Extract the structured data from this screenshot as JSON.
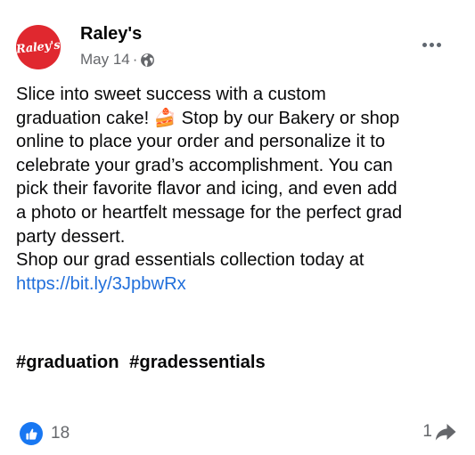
{
  "post": {
    "author": "Raley's",
    "avatar_text": "Raley's",
    "date": "May 14",
    "separator": "·",
    "text_lines": [
      "Slice into sweet success with a custom",
      "graduation cake! 🍰 Stop by our Bakery or shop",
      "online to place your order and personalize it to",
      "celebrate your grad’s accomplishment. You can",
      "pick their favorite flavor and icing, and even add",
      "a photo or heartfelt message for the perfect grad",
      "party dessert.",
      "Shop our grad essentials collection today at"
    ],
    "link": "https://bit.ly/3JpbwRx",
    "hashtags": [
      "#graduation",
      "#gradessentials"
    ],
    "reaction_count": "18",
    "share_count": "1",
    "icons": {
      "audience": "globe-icon",
      "menu": "more-options-icon",
      "reaction": "thumbs-up-icon",
      "share": "share-arrow-icon"
    },
    "colors": {
      "brand_red": "#e0282f",
      "link_blue": "#216fdb",
      "like_blue": "#1877f2",
      "meta_gray": "#65676b"
    }
  }
}
